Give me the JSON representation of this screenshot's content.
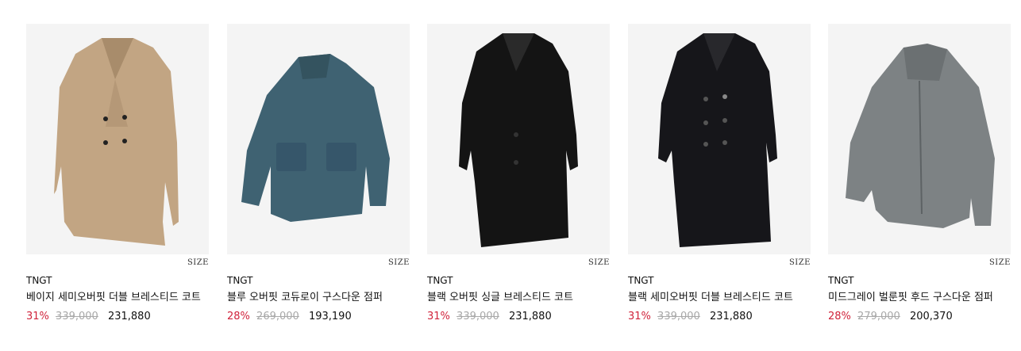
{
  "products": [
    {
      "size_label": "SIZE",
      "brand": "TNGT",
      "name": "베이지 세미오버핏 더블 브레스티드 코트",
      "discount": "31%",
      "original_price": "339,000",
      "sale_price": "231,880",
      "color": "#c2a583"
    },
    {
      "size_label": "SIZE",
      "brand": "TNGT",
      "name": "블루 오버핏 코듀로이 구스다운 점퍼",
      "discount": "28%",
      "original_price": "269,000",
      "sale_price": "193,190",
      "color": "#3f6272"
    },
    {
      "size_label": "SIZE",
      "brand": "TNGT",
      "name": "블랙 오버핏 싱글 브레스티드 코트",
      "discount": "31%",
      "original_price": "339,000",
      "sale_price": "231,880",
      "color": "#141414"
    },
    {
      "size_label": "SIZE",
      "brand": "TNGT",
      "name": "블랙 세미오버핏 더블 브레스티드 코트",
      "discount": "31%",
      "original_price": "339,000",
      "sale_price": "231,880",
      "color": "#16161a"
    },
    {
      "size_label": "SIZE",
      "brand": "TNGT",
      "name": "미드그레이 벌룬핏 후드 구스다운 점퍼",
      "discount": "28%",
      "original_price": "279,000",
      "sale_price": "200,370",
      "color": "#7d8284"
    }
  ]
}
